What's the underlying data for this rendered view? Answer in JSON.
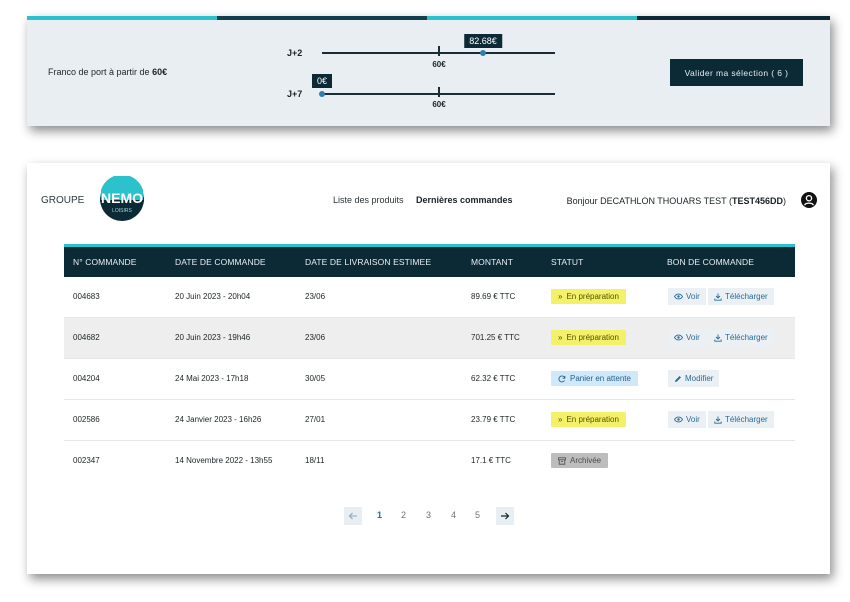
{
  "shipping": {
    "franco_prefix": "Franco de port à partir de ",
    "franco_amount": "60€",
    "sliders": [
      {
        "label": "J+2",
        "value_label": "82.68€",
        "threshold_label": "60€",
        "value": 82.68,
        "threshold": 60
      },
      {
        "label": "J+7",
        "value_label": "0€",
        "threshold_label": "60€",
        "value": 0,
        "threshold": 60
      }
    ],
    "validate_label": "Valider ma sélection ( 6 )",
    "colors": {
      "stripe_1": "#2bc2cc",
      "stripe_2": "#143e50",
      "stripe_3": "#2bc2cc",
      "stripe_4": "#0c2a36"
    }
  },
  "header": {
    "logo_prefix": "GROUPE",
    "logo_main": "NEMO",
    "logo_sub": "LOISIRS",
    "nav": [
      "Liste des produits",
      "Dernières commandes"
    ],
    "greeting_prefix": "Bonjour DECATHLON THOUARS TEST (",
    "greeting_code": "TEST456DD",
    "greeting_suffix": ")",
    "user_icon": "user-circle-icon"
  },
  "table": {
    "headers": [
      "N° COMMANDE",
      "DATE DE COMMANDE",
      "DATE DE LIVRAISON ESTIMEE",
      "MONTANT",
      "STATUT",
      "BON DE COMMANDE"
    ],
    "rows": [
      {
        "num": "004683",
        "date": "20 Juin 2023 - 20h04",
        "delivery": "23/06",
        "amount": "89.69 € TTC",
        "status": "En préparation"
      },
      {
        "num": "004682",
        "date": "20 Juin 2023 - 19h46",
        "delivery": "23/06",
        "amount": "701.25 € TTC",
        "status": "En préparation"
      },
      {
        "num": "004204",
        "date": "24 Mai 2023 - 17h18",
        "delivery": "30/05",
        "amount": "62.32 € TTC",
        "status": "Panier en attente"
      },
      {
        "num": "002586",
        "date": "24 Janvier 2023 - 16h26",
        "delivery": "27/01",
        "amount": "23.79 € TTC",
        "status": "En préparation"
      },
      {
        "num": "002347",
        "date": "14 Novembre 2022 - 13h55",
        "delivery": "18/11",
        "amount": "17.1 € TTC",
        "status": "Archivée"
      }
    ],
    "actions": {
      "view": "Voir",
      "download": "Télécharger",
      "edit": "Modifier"
    },
    "colors": {
      "header_bg": "#0c2a36",
      "accent": "#2bc2cc",
      "prep": "#f3f06a",
      "wait": "#cfe9fb",
      "archive": "#bdbdbd"
    }
  },
  "pagination": {
    "pages": [
      "1",
      "2",
      "3",
      "4",
      "5"
    ],
    "current": "1",
    "prev_icon": "arrow-left-icon",
    "next_icon": "arrow-right-icon"
  }
}
